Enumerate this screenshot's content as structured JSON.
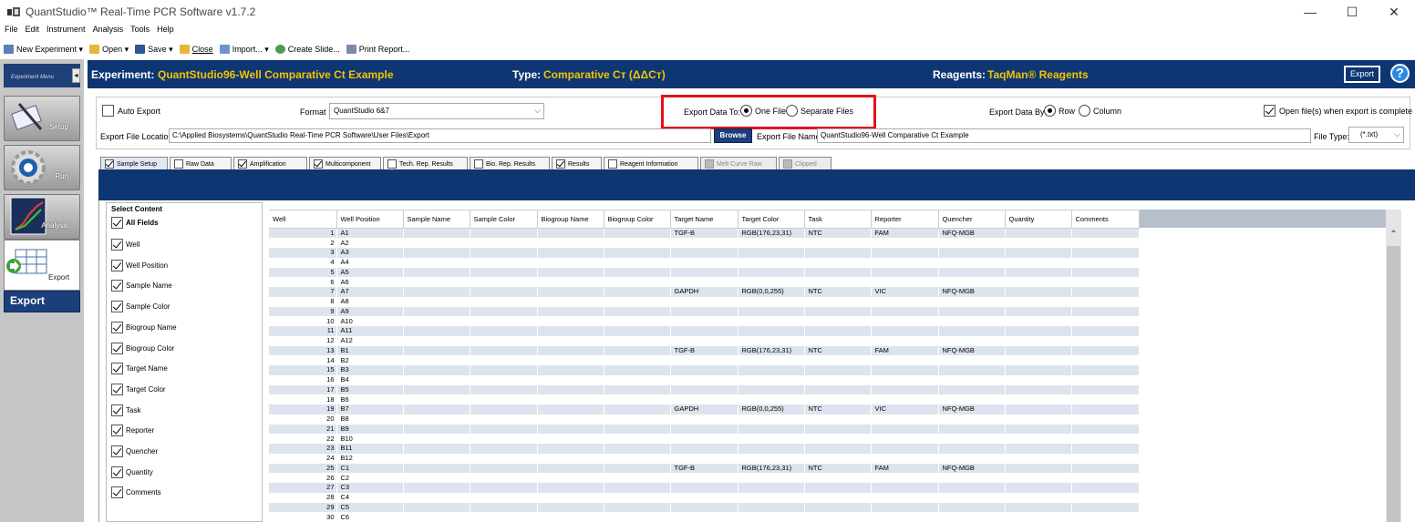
{
  "window": {
    "title": "QuantStudio™ Real-Time PCR Software v1.7.2"
  },
  "menu": [
    "File",
    "Edit",
    "Instrument",
    "Analysis",
    "Tools",
    "Help"
  ],
  "toolbar": {
    "new_experiment": "New Experiment",
    "open": "Open",
    "save": "Save",
    "close": "Close",
    "import": "Import...",
    "create_slide": "Create Slide...",
    "print_report": "Print Report..."
  },
  "nav": {
    "header": "Experiment Menu",
    "setup": "Setup",
    "run": "Run",
    "analysis": "Analysis",
    "export": "Export",
    "export_active": "Export"
  },
  "header": {
    "experiment_label": "Experiment:",
    "experiment_value": "QuantStudio96-Well Comparative Ct Example",
    "type_label": "Type:",
    "type_value": "Comparative Cт (ΔΔCт)",
    "reagents_label": "Reagents:",
    "reagents_value": "TaqMan® Reagents",
    "export_button": "Export",
    "help": "?"
  },
  "options": {
    "auto_export": "Auto Export",
    "format_label": "Format :",
    "format_value": "QuantStudio 6&7",
    "export_data_to_label": "Export Data To:",
    "one_file": "One File",
    "separate_files": "Separate Files",
    "export_data_by_label": "Export Data By:",
    "row": "Row",
    "column": "Column",
    "open_files": "Open file(s) when export is complete",
    "file_location_label": "Export File Location:",
    "file_location_value": "C:\\Applied Biosystems\\QuantStudio Real-Time PCR Software\\User Files\\Export",
    "browse": "Browse",
    "file_name_label": "Export File Name:",
    "file_name_value": "QuantStudio96-Well Comparative Ct Example",
    "file_type_label": "File Type:",
    "file_type_value": "(*.txt)"
  },
  "tabs": [
    {
      "label": "Sample Setup",
      "checked": true
    },
    {
      "label": "Raw Data",
      "checked": false
    },
    {
      "label": "Amplification",
      "checked": true
    },
    {
      "label": "Multicomponent",
      "checked": true
    },
    {
      "label": "Tech. Rep. Results",
      "checked": false
    },
    {
      "label": "Bio. Rep. Results",
      "checked": false
    },
    {
      "label": "Results",
      "checked": true
    },
    {
      "label": "Reagent Information",
      "checked": false
    },
    {
      "label": "Melt Curve Raw",
      "checked": false
    },
    {
      "label": "Clipped",
      "checked": false
    }
  ],
  "select_content": {
    "title": "Select Content",
    "items": [
      "All Fields",
      "Well",
      "Well Position",
      "Sample Name",
      "Sample Color",
      "Biogroup Name",
      "Biogroup Color",
      "Target Name",
      "Target Color",
      "Task",
      "Reporter",
      "Quencher",
      "Quantity",
      "Comments"
    ]
  },
  "table": {
    "columns": [
      "Well",
      "Well Position",
      "Sample Name",
      "Sample Color",
      "Biogroup Name",
      "Biogroup Color",
      "Target Name",
      "Target Color",
      "Task",
      "Reporter",
      "Quencher",
      "Quantity",
      "Comments"
    ],
    "rows": [
      [
        "1",
        "A1",
        "",
        "",
        "",
        "",
        "TGF-B",
        "RGB(176,23,31)",
        "NTC",
        "FAM",
        "NFQ-MGB",
        "",
        ""
      ],
      [
        "2",
        "A2",
        "",
        "",
        "",
        "",
        "",
        "",
        "",
        "",
        "",
        "",
        ""
      ],
      [
        "3",
        "A3",
        "",
        "",
        "",
        "",
        "",
        "",
        "",
        "",
        "",
        "",
        ""
      ],
      [
        "4",
        "A4",
        "",
        "",
        "",
        "",
        "",
        "",
        "",
        "",
        "",
        "",
        ""
      ],
      [
        "5",
        "A5",
        "",
        "",
        "",
        "",
        "",
        "",
        "",
        "",
        "",
        "",
        ""
      ],
      [
        "6",
        "A6",
        "",
        "",
        "",
        "",
        "",
        "",
        "",
        "",
        "",
        "",
        ""
      ],
      [
        "7",
        "A7",
        "",
        "",
        "",
        "",
        "GAPDH",
        "RGB(0,0,255)",
        "NTC",
        "VIC",
        "NFQ-MGB",
        "",
        ""
      ],
      [
        "8",
        "A8",
        "",
        "",
        "",
        "",
        "",
        "",
        "",
        "",
        "",
        "",
        ""
      ],
      [
        "9",
        "A9",
        "",
        "",
        "",
        "",
        "",
        "",
        "",
        "",
        "",
        "",
        ""
      ],
      [
        "10",
        "A10",
        "",
        "",
        "",
        "",
        "",
        "",
        "",
        "",
        "",
        "",
        ""
      ],
      [
        "11",
        "A11",
        "",
        "",
        "",
        "",
        "",
        "",
        "",
        "",
        "",
        "",
        ""
      ],
      [
        "12",
        "A12",
        "",
        "",
        "",
        "",
        "",
        "",
        "",
        "",
        "",
        "",
        ""
      ],
      [
        "13",
        "B1",
        "",
        "",
        "",
        "",
        "TGF-B",
        "RGB(176,23,31)",
        "NTC",
        "FAM",
        "NFQ-MGB",
        "",
        ""
      ],
      [
        "14",
        "B2",
        "",
        "",
        "",
        "",
        "",
        "",
        "",
        "",
        "",
        "",
        ""
      ],
      [
        "15",
        "B3",
        "",
        "",
        "",
        "",
        "",
        "",
        "",
        "",
        "",
        "",
        ""
      ],
      [
        "16",
        "B4",
        "",
        "",
        "",
        "",
        "",
        "",
        "",
        "",
        "",
        "",
        ""
      ],
      [
        "17",
        "B5",
        "",
        "",
        "",
        "",
        "",
        "",
        "",
        "",
        "",
        "",
        ""
      ],
      [
        "18",
        "B6",
        "",
        "",
        "",
        "",
        "",
        "",
        "",
        "",
        "",
        "",
        ""
      ],
      [
        "19",
        "B7",
        "",
        "",
        "",
        "",
        "GAPDH",
        "RGB(0,0,255)",
        "NTC",
        "VIC",
        "NFQ-MGB",
        "",
        ""
      ],
      [
        "20",
        "B8",
        "",
        "",
        "",
        "",
        "",
        "",
        "",
        "",
        "",
        "",
        ""
      ],
      [
        "21",
        "B9",
        "",
        "",
        "",
        "",
        "",
        "",
        "",
        "",
        "",
        "",
        ""
      ],
      [
        "22",
        "B10",
        "",
        "",
        "",
        "",
        "",
        "",
        "",
        "",
        "",
        "",
        ""
      ],
      [
        "23",
        "B11",
        "",
        "",
        "",
        "",
        "",
        "",
        "",
        "",
        "",
        "",
        ""
      ],
      [
        "24",
        "B12",
        "",
        "",
        "",
        "",
        "",
        "",
        "",
        "",
        "",
        "",
        ""
      ],
      [
        "25",
        "C1",
        "",
        "",
        "",
        "",
        "TGF-B",
        "RGB(176,23,31)",
        "NTC",
        "FAM",
        "NFQ-MGB",
        "",
        ""
      ],
      [
        "26",
        "C2",
        "",
        "",
        "",
        "",
        "",
        "",
        "",
        "",
        "",
        "",
        ""
      ],
      [
        "27",
        "C3",
        "",
        "",
        "",
        "",
        "",
        "",
        "",
        "",
        "",
        "",
        ""
      ],
      [
        "28",
        "C4",
        "",
        "",
        "",
        "",
        "",
        "",
        "",
        "",
        "",
        "",
        ""
      ],
      [
        "29",
        "C5",
        "",
        "",
        "",
        "",
        "",
        "",
        "",
        "",
        "",
        "",
        ""
      ],
      [
        "30",
        "C6",
        "",
        "",
        "",
        "",
        "",
        "",
        "",
        "",
        "",
        "",
        ""
      ]
    ]
  }
}
